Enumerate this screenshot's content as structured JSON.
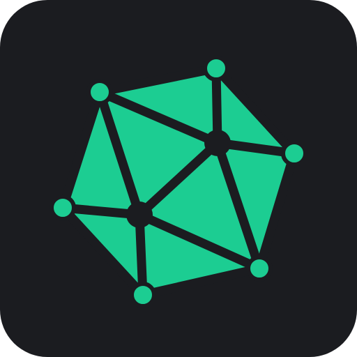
{
  "icon": {
    "name": "network-mesh-app-icon",
    "background_color": "#1b1c20",
    "accent_color": "#1ccd92",
    "stroke_color": "#1b1c20"
  }
}
